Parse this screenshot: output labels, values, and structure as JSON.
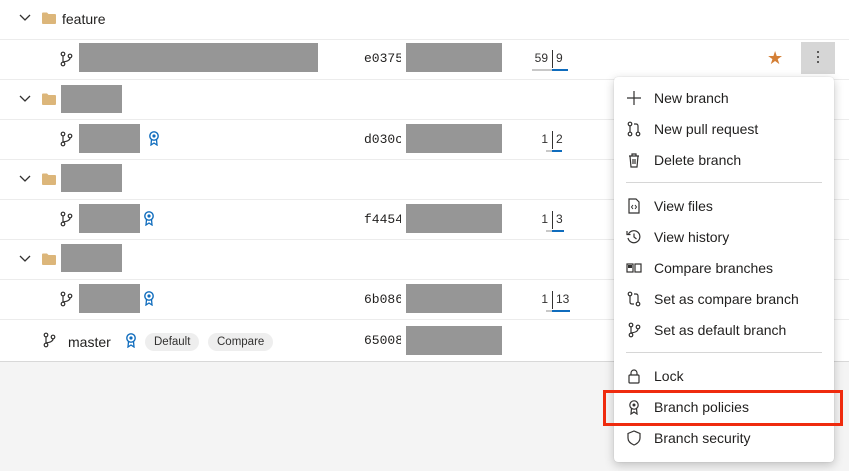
{
  "rows": {
    "folder_feature": {
      "name": "feature"
    },
    "branch_1": {
      "commit": "e0375",
      "behind": "59",
      "ahead": "9"
    },
    "branch_2": {
      "commit": "d030c",
      "behind": "1",
      "ahead": "2"
    },
    "branch_3": {
      "commit": "f4454",
      "behind": "1",
      "ahead": "3"
    },
    "branch_4": {
      "commit": "6b086",
      "behind": "1",
      "ahead": "13"
    },
    "master": {
      "name": "master",
      "commit": "65008",
      "default_label": "Default",
      "compare_label": "Compare"
    }
  },
  "menu": {
    "items": [
      {
        "label": "New branch",
        "icon": "plus-icon"
      },
      {
        "label": "New pull request",
        "icon": "pull-request-icon"
      },
      {
        "label": "Delete branch",
        "icon": "trash-icon"
      },
      {
        "label": "View files",
        "icon": "file-code-icon"
      },
      {
        "label": "View history",
        "icon": "history-icon"
      },
      {
        "label": "Compare branches",
        "icon": "compare-icon"
      },
      {
        "label": "Set as compare branch",
        "icon": "compare-branch-icon"
      },
      {
        "label": "Set as default branch",
        "icon": "branch-icon"
      },
      {
        "label": "Lock",
        "icon": "lock-icon"
      },
      {
        "label": "Branch policies",
        "icon": "policy-icon"
      },
      {
        "label": "Branch security",
        "icon": "shield-icon"
      }
    ]
  },
  "colors": {
    "accent": "#0f6cbd",
    "star": "#d47f36",
    "folder": "#dcb67a",
    "highlight": "#ef2b0e"
  }
}
